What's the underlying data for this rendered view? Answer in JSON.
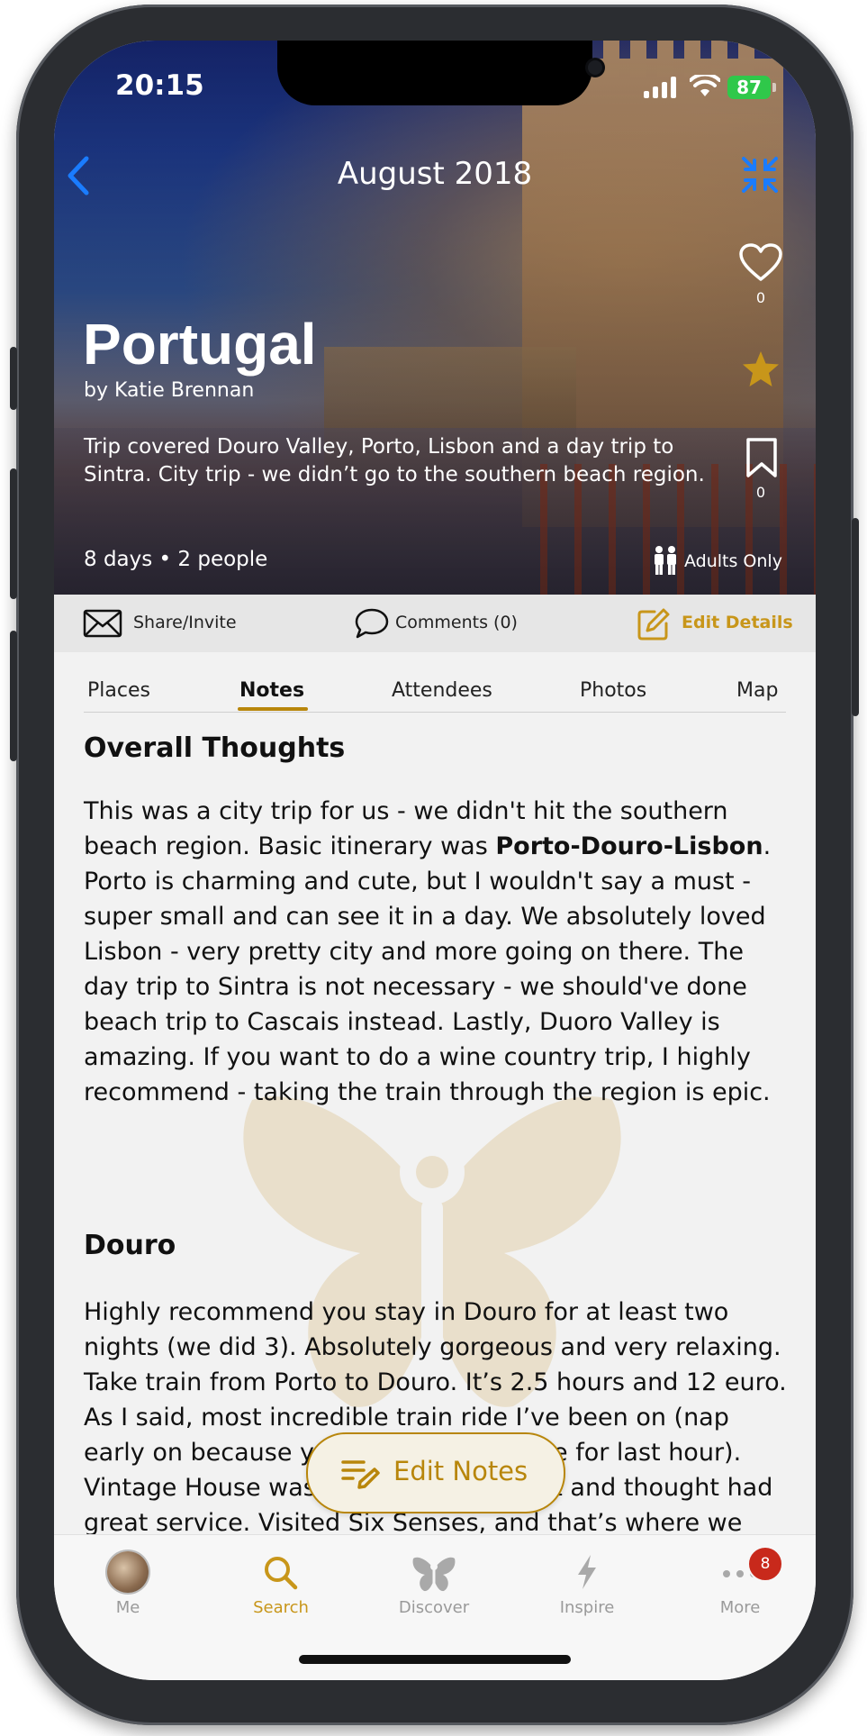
{
  "status_bar": {
    "time": "20:15",
    "battery": "87"
  },
  "header": {
    "title": "August 2018"
  },
  "trip": {
    "name": "Portugal",
    "author": "by Katie Brennan",
    "description": "Trip covered Douro Valley, Porto, Lisbon and a day trip to Sintra. City trip - we didn’t go to the southern beach region.",
    "meta": "8 days • 2 people",
    "audience": "Adults Only",
    "likes": "0",
    "saves": "0"
  },
  "actions": {
    "share": "Share/Invite",
    "comments": "Comments (0)",
    "edit": "Edit Details"
  },
  "tabs": [
    {
      "label": "Places"
    },
    {
      "label": "Notes"
    },
    {
      "label": "Attendees"
    },
    {
      "label": "Photos"
    },
    {
      "label": "Map"
    }
  ],
  "notes": {
    "section1_title": "Overall Thoughts",
    "p1_a": "This was a city trip for us - we didn't hit the southern beach region. Basic itinerary was ",
    "p1_bold": "Porto-Douro-Lisbon",
    "p1_b": ". Porto is charming and cute, but I wouldn't say a must - super small and can see it in a day. We absolutely loved Lisbon - very pretty city and more going on there. The day trip to Sintra is not necessary - we should've done beach trip to Cascais instead. Lastly, Duoro Valley is amazing. If you want to do a wine country trip, I highly recommend - taking the train through the region is epic.",
    "section2_title": "Douro",
    "p2": "Highly recommend you stay in Douro for at least two nights (we did 3). Absolutely gorgeous and very relaxing. Take train from Porto to Douro. It’s 2.5 hours and 12 euro. As I said, most incredible train ride I’ve been on (nap early on because you want to be awake for last hour).  Vintage House was where we stayed at and thought had great service. Visited Six Senses, and that’s where we were originally supposed to stay"
  },
  "edit_notes_label": "Edit Notes",
  "tab_bar": [
    {
      "label": "Me"
    },
    {
      "label": "Search"
    },
    {
      "label": "Discover"
    },
    {
      "label": "Inspire"
    },
    {
      "label": "More",
      "badge": "8"
    }
  ],
  "colors": {
    "accent": "#b8860b",
    "link_blue": "#1a7cff",
    "badge_red": "#c8291b"
  }
}
